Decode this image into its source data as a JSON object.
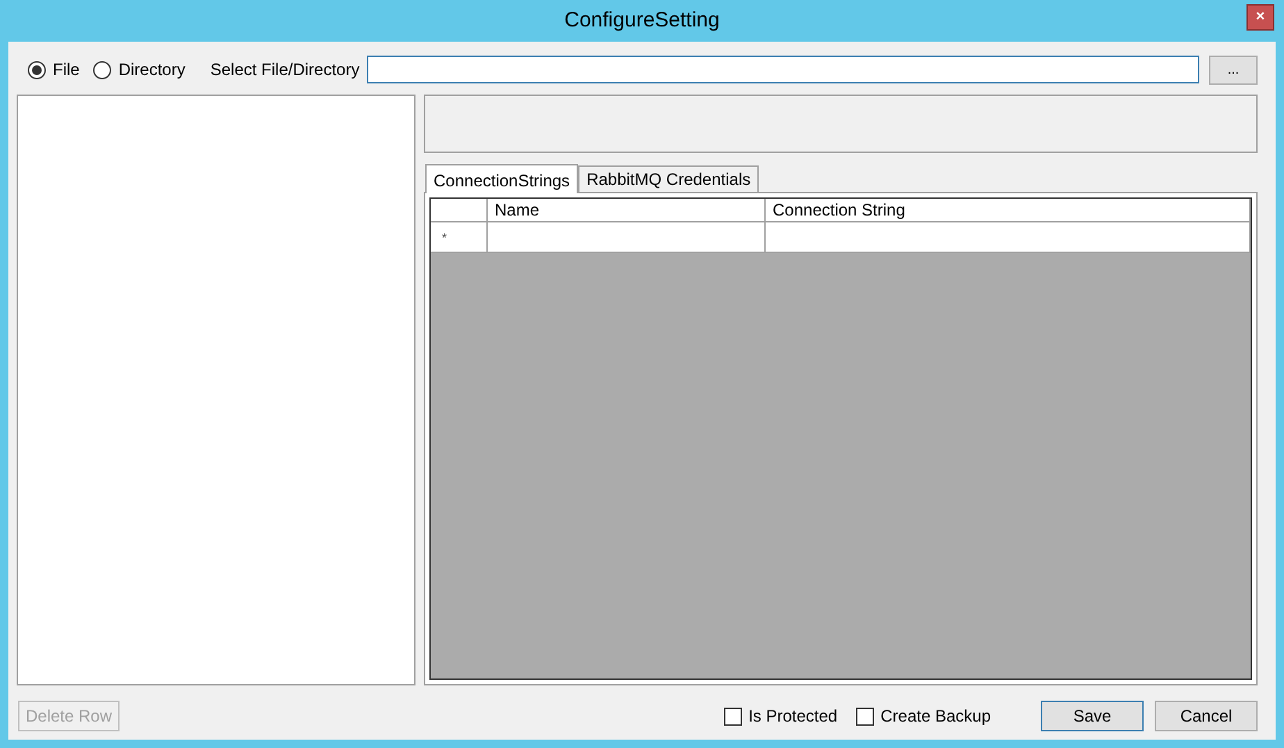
{
  "window": {
    "title": "ConfigureSetting",
    "close": "×"
  },
  "source_options": [
    {
      "label": "File",
      "selected": true
    },
    {
      "label": "Directory",
      "selected": false
    }
  ],
  "path_label": "Select File/Directory",
  "browse_button": "...",
  "tabs": [
    {
      "label": "ConnectionStrings",
      "selected": true
    },
    {
      "label": "RabbitMQ Credentials",
      "selected": false
    }
  ],
  "grid": {
    "columns": [
      "Name",
      "Connection String"
    ],
    "new_row_marker": "*"
  },
  "delete_button": {
    "label": "Delete Row",
    "disabled": true
  },
  "options": [
    {
      "label": "Is Protected",
      "checked": false
    },
    {
      "label": "Create Backup",
      "checked": false
    }
  ],
  "buttons": [
    {
      "label": "Save",
      "default": true
    },
    {
      "label": "Cancel",
      "default": false
    }
  ]
}
